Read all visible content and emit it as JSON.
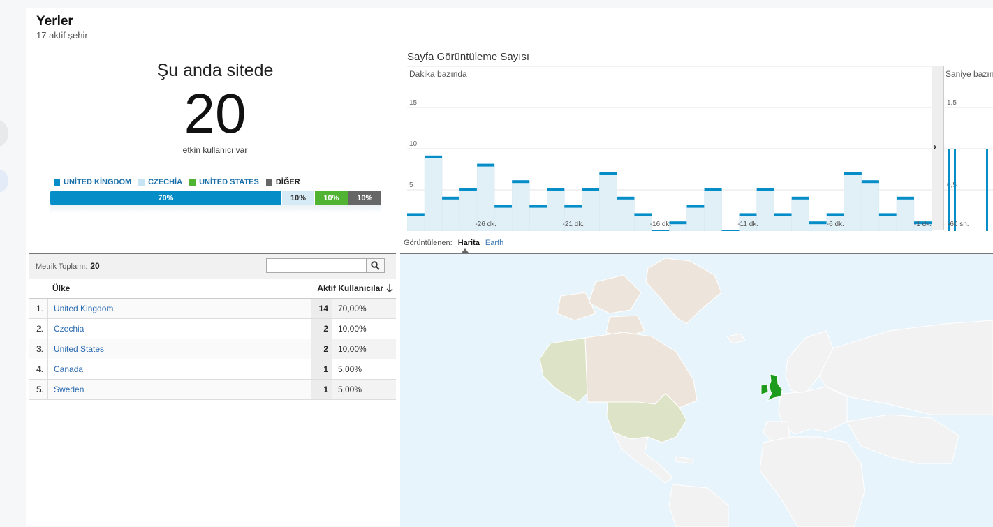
{
  "header": {
    "title": "Yerler",
    "subtitle": "17 aktif şehir"
  },
  "summary": {
    "heading": "Şu anda sitede",
    "active_count": "20",
    "caption": "etkin kullanıcı var"
  },
  "legend": [
    {
      "label": "UNİTED KİNGDOM",
      "color": "#058dc7"
    },
    {
      "label": "CZECHİA",
      "color": "#c6e4f1"
    },
    {
      "label": "UNİTED STATES",
      "color": "#50b432"
    },
    {
      "label": "DİĞER",
      "color": "#666666"
    }
  ],
  "share_bar": [
    {
      "label": "70%",
      "value": 70,
      "color": "#058dc7",
      "text_color": "#ffffff"
    },
    {
      "label": "10%",
      "value": 10,
      "color": "#d6ebf5",
      "text_color": "#333333"
    },
    {
      "label": "10%",
      "value": 10,
      "color": "#50b432",
      "text_color": "#ffffff"
    },
    {
      "label": "10%",
      "value": 10,
      "color": "#666666",
      "text_color": "#ffffff"
    }
  ],
  "pageviews_chart": {
    "title": "Sayfa Görüntüleme Sayısı",
    "left_subtitle": "Dakika bazında",
    "right_subtitle": "Saniye bazında"
  },
  "chart_data": [
    {
      "type": "bar",
      "title": "Sayfa Görüntüleme Sayısı",
      "subtitle": "Dakika bazında",
      "x_tick_labels": [
        "-26 dk.",
        "-21 dk.",
        "-16 dk.",
        "-11 dk.",
        "-6 dk.",
        "-1 dk."
      ],
      "y_tick_labels": [
        "5",
        "10",
        "15"
      ],
      "ylim": [
        0,
        20
      ],
      "categories": [
        "-30",
        "-29",
        "-28",
        "-27",
        "-26",
        "-25",
        "-24",
        "-23",
        "-22",
        "-21",
        "-20",
        "-19",
        "-18",
        "-17",
        "-16",
        "-15",
        "-14",
        "-13",
        "-12",
        "-11",
        "-10",
        "-9",
        "-8",
        "-7",
        "-6",
        "-5",
        "-4",
        "-3",
        "-2",
        "-1"
      ],
      "values": [
        2,
        9,
        4,
        5,
        8,
        3,
        6,
        3,
        5,
        3,
        5,
        7,
        4,
        2,
        0,
        1,
        3,
        5,
        0,
        2,
        5,
        2,
        4,
        1,
        2,
        7,
        6,
        2,
        4,
        1
      ],
      "color": "#058dc7",
      "fill": "#e1f0f7",
      "grid": true
    },
    {
      "type": "bar",
      "subtitle": "Saniye bazında",
      "x_tick_labels": [
        "-60 sn."
      ],
      "y_tick_labels": [
        "0,5",
        "1,5"
      ],
      "ylim": [
        0,
        2
      ],
      "values": [
        1,
        1,
        1
      ],
      "color": "#058dc7",
      "grid": true
    }
  ],
  "view_toggle": {
    "label": "Görüntülenen:",
    "active": "Harita",
    "other": "Earth"
  },
  "table": {
    "metric_label": "Metrik Toplamı:",
    "metric_value": "20",
    "search_placeholder": "",
    "columns": {
      "country": "Ülke",
      "users": "Aktif Kullanıcılar"
    },
    "rows": [
      {
        "index": "1.",
        "country": "United Kingdom",
        "count": "14",
        "percent": "70,00%"
      },
      {
        "index": "2.",
        "country": "Czechia",
        "count": "2",
        "percent": "10,00%"
      },
      {
        "index": "3.",
        "country": "United States",
        "count": "2",
        "percent": "10,00%"
      },
      {
        "index": "4.",
        "country": "Canada",
        "count": "1",
        "percent": "5,00%"
      },
      {
        "index": "5.",
        "country": "Sweden",
        "count": "1",
        "percent": "5,00%"
      }
    ]
  },
  "map": {
    "colors": {
      "water": "#e8f4fb",
      "land": "#f2f2f2",
      "highlight_low": "#dde3c6",
      "highlight_high": "#1c9b1c",
      "border": "#ffffff"
    }
  }
}
